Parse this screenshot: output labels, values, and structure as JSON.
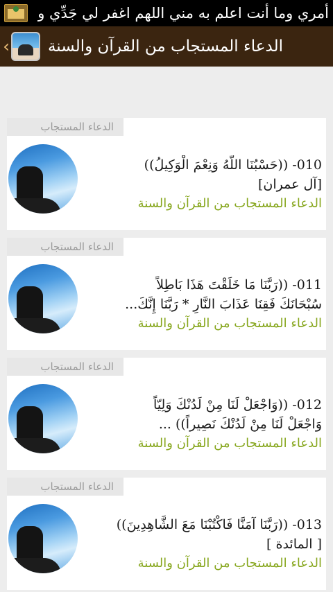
{
  "status_bar": {
    "notification_text": "أمري وما أنت اعلم به مني اللهم اغفر لي جَدِّي وهزلي"
  },
  "action_bar": {
    "title": "الدعاء المستجاب من القرآن والسنة"
  },
  "cards": [
    {
      "category": "الدعاء المستجاب",
      "line1": "010- ((حَسْبُنَا اللَّهُ وَنِعْمَ الْوَكِيلُ))",
      "line2": "[آل عمران]",
      "source": "الدعاء المستجاب من القرآن والسنة"
    },
    {
      "category": "الدعاء المستجاب",
      "line1": "011- ((رَبَّنَا مَا خَلَقْتَ هَذَا بَاطِلاً",
      "line2": "سُبْحَانَكَ فَقِنَا عَذَابَ النَّارِ * رَبَّنَا إِنَّكَ...",
      "source": "الدعاء المستجاب من القرآن والسنة"
    },
    {
      "category": "الدعاء المستجاب",
      "line1": "012- ((وَاجْعَلْ لَنَا مِنْ لَدُنْكَ وَلِيّاً",
      "line2": "وَاجْعَلْ لَنَا مِنْ لَدُنْكَ نَصِيراً)) ...",
      "source": "الدعاء المستجاب من القرآن والسنة"
    },
    {
      "category": "الدعاء المستجاب",
      "line1": "013- ((رَبَّنَا آمَنَّا فَاكْتُبْنَا مَعَ الشَّاهِدِينَ))",
      "line2": "[ المائدة ]",
      "source": "الدعاء المستجاب من القرآن والسنة"
    }
  ],
  "colors": {
    "action_bar_bg": "#3b2510",
    "source_text": "#86a61c",
    "page_bg": "#ededed"
  },
  "icons": {
    "status_app_icon": "app-notification-icon",
    "back": "chevron-left-icon",
    "logo": "app-logo-icon",
    "thumbnail": "praying-person-thumbnail"
  }
}
